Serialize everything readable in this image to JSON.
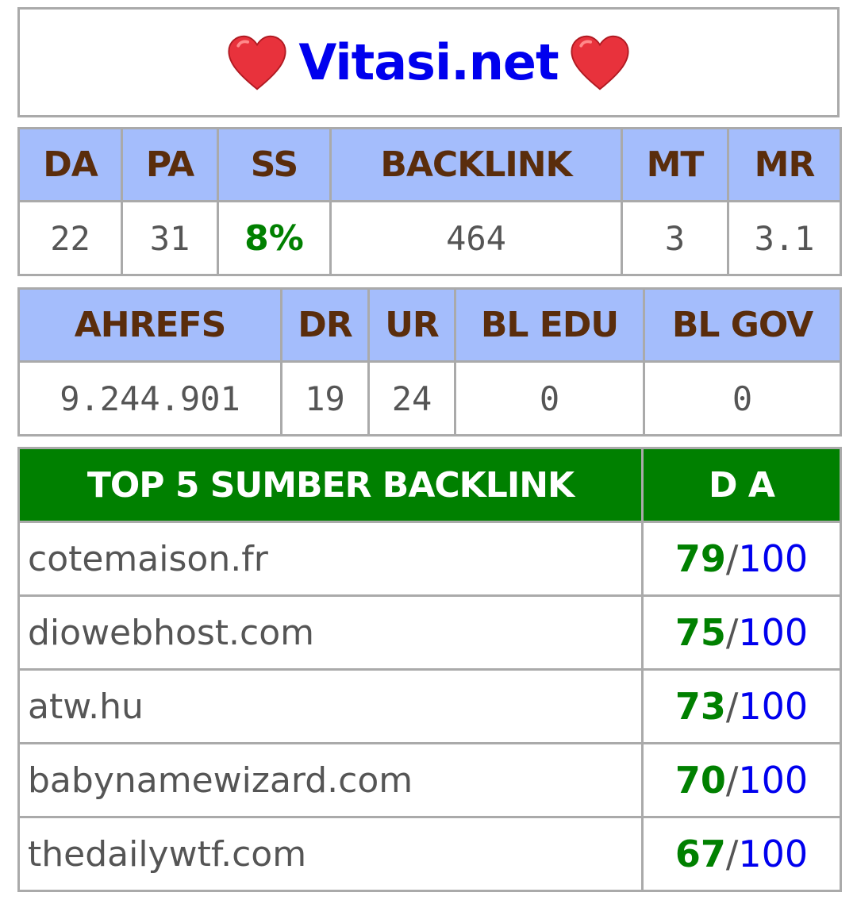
{
  "header": {
    "title": "Vitasi.net",
    "left_icon": "heart-icon",
    "right_icon": "heart-icon"
  },
  "moz": {
    "headers": [
      "DA",
      "PA",
      "SS",
      "BACKLINK",
      "MT",
      "MR"
    ],
    "values": [
      "22",
      "31",
      "8%",
      "464",
      "3",
      "3.1"
    ]
  },
  "ahrefs": {
    "headers": [
      "AHREFS",
      "DR",
      "UR",
      "BL EDU",
      "BL GOV"
    ],
    "values": [
      "9.244.901",
      "19",
      "24",
      "0",
      "0"
    ]
  },
  "top": {
    "title": "TOP 5 SUMBER BACKLINK",
    "da_header": "D A",
    "rows": [
      {
        "site": "cotemaison.fr",
        "da": "79",
        "max": "100"
      },
      {
        "site": "diowebhost.com",
        "da": "75",
        "max": "100"
      },
      {
        "site": "atw.hu",
        "da": "73",
        "max": "100"
      },
      {
        "site": "babynamewizard.com",
        "da": "70",
        "max": "100"
      },
      {
        "site": "thedailywtf.com",
        "da": "67",
        "max": "100"
      }
    ],
    "separator": "/"
  },
  "colors": {
    "header_bg": "#a4bdfc",
    "header_text": "#5a2d0c",
    "top_bg": "#008000",
    "link_blue": "#0000ee",
    "heart": "#e8323c"
  }
}
